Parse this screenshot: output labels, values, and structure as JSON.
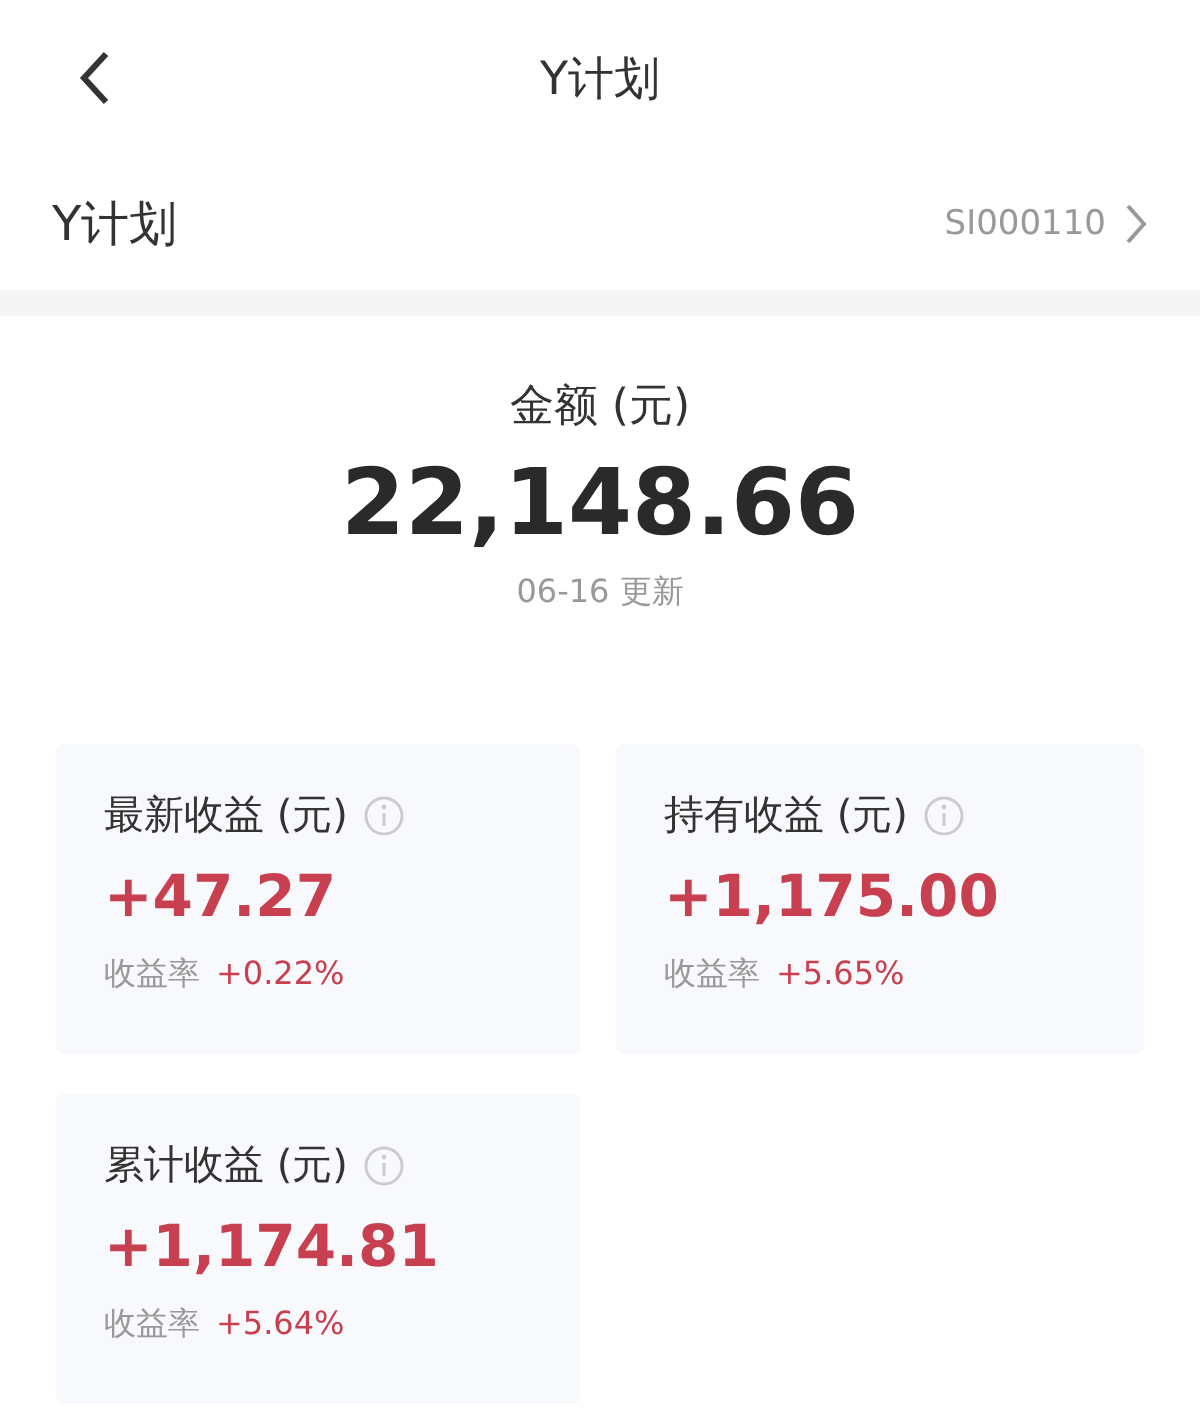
{
  "nav": {
    "title": "Y计划"
  },
  "plan": {
    "name": "Y计划",
    "code": "SI000110"
  },
  "summary": {
    "label": "金额 (元)",
    "amount": "22,148.66",
    "updated": "06-16 更新"
  },
  "cards": [
    {
      "title": "最新收益 (元)",
      "value": "+47.27",
      "rate_label": "收益率",
      "rate": "+0.22%"
    },
    {
      "title": "持有收益 (元)",
      "value": "+1,175.00",
      "rate_label": "收益率",
      "rate": "+5.65%"
    },
    {
      "title": "累计收益 (元)",
      "value": "+1,174.81",
      "rate_label": "收益率",
      "rate": "+5.64%"
    }
  ]
}
